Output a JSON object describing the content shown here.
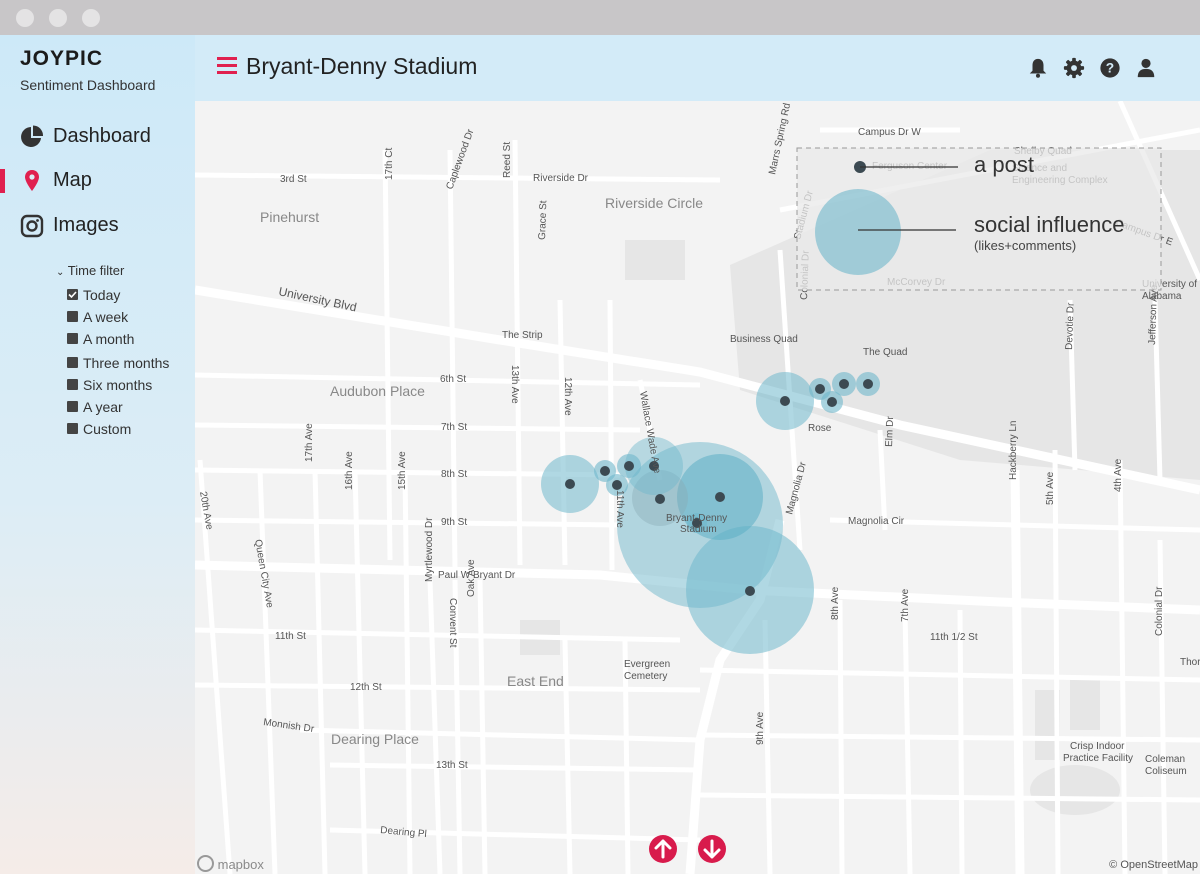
{
  "sidebar": {
    "brand": "JOYPIC",
    "subtitle": "Sentiment Dashboard",
    "nav": [
      {
        "label": "Dashboard",
        "icon": "pie-chart-icon",
        "active": false
      },
      {
        "label": "Map",
        "icon": "map-pin-icon",
        "active": true
      },
      {
        "label": "Images",
        "icon": "instagram-icon",
        "active": false
      }
    ],
    "filter": {
      "title": "Time filter",
      "options": [
        {
          "label": "Today",
          "checked": true
        },
        {
          "label": "A week",
          "checked": false
        },
        {
          "label": "A month",
          "checked": false
        },
        {
          "label": "Three months",
          "checked": false
        },
        {
          "label": "Six months",
          "checked": false
        },
        {
          "label": "A year",
          "checked": false
        },
        {
          "label": "Custom",
          "checked": false
        }
      ]
    }
  },
  "header": {
    "title": "Bryant-Denny Stadium",
    "icons": [
      "bell-icon",
      "gear-icon",
      "help-icon",
      "user-icon"
    ]
  },
  "legend": {
    "post": "a post",
    "influence": "social influence",
    "influence_sub": "(likes+comments)"
  },
  "map": {
    "labels": [
      "Campus Dr W",
      "Shelby Quad",
      "Ferguson Center",
      "Science and",
      "Engineering Complex",
      "3rd St",
      "17th Ct",
      "Caplewood Dr",
      "Reed St",
      "Riverside Dr",
      "Riverside Circle",
      "Marrs Spring Rd",
      "Pinehurst",
      "Grace St",
      "Stadium Dr",
      "Campus Dr E",
      "McCorvey Dr",
      "University Blvd",
      "University of",
      "Alabama",
      "The Strip",
      "Business Quad",
      "Colonial Dr",
      "The Quad",
      "Devotie Dr",
      "Jefferson Ave",
      "Audubon Place",
      "6th St",
      "13th Ave",
      "12th Ave",
      "Wallace Wade Ave",
      "Rose",
      "7th St",
      "8th St",
      "9th St",
      "11th Ave",
      "Bryant-Denny",
      "Stadium",
      "Magnolia Dr",
      "Magnolia Cir",
      "Elm Dr",
      "Hackberry Ln",
      "5th Ave",
      "4th Ave",
      "20th Ave",
      "17th Ave",
      "16th Ave",
      "15th Ave",
      "Queen City Ave",
      "Paul W Bryant Dr",
      "Myrtlewood Dr",
      "Convent St",
      "Oak Ave",
      "11th St",
      "8th Ave",
      "7th Ave",
      "11th 1/2 St",
      "Colonial Dr",
      "Coleman",
      "Evergreen",
      "Cemetery",
      "East End",
      "12th St",
      "Monnish Dr",
      "Dearing Place",
      "13th St",
      "Crisp Indoor",
      "Practice Facility",
      "Coliseum",
      "Dearing Pl",
      "9th Ave",
      "Thor"
    ],
    "attribution": "© OpenStreetMap",
    "provider": "mapbox"
  },
  "colors": {
    "accent": "#e0204f",
    "bubble": "#6fb8cc",
    "dot": "#3c4a52"
  }
}
